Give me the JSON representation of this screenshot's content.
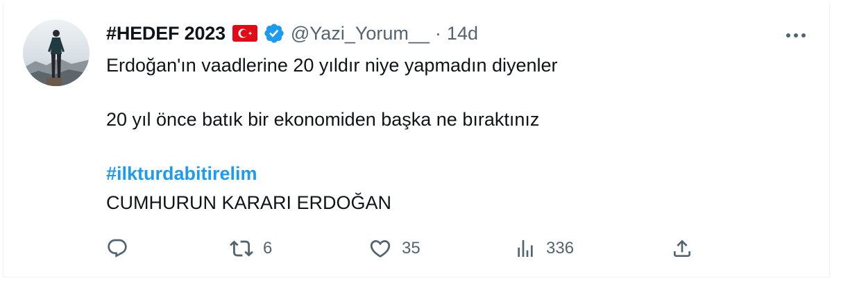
{
  "tweet": {
    "display_name": "#HEDEF 2023",
    "handle": "@Yazi_Yorum__",
    "separator": "·",
    "time": "14d",
    "lines": [
      "Erdoğan'ın vaadlerine 20 yıldır niye yapmadın diyenler",
      "20 yıl önce batık bir ekonomiden başka ne bıraktınız"
    ],
    "hashtag": "#ilkturdabitirelim",
    "closing_line": "CUMHURUN KARARI ERDOĞAN",
    "flag_icon": "turkey-flag-icon",
    "verified_icon": "verified-badge-icon"
  },
  "actions": {
    "reply": {
      "icon": "reply-icon",
      "count": ""
    },
    "retweet": {
      "icon": "retweet-icon",
      "count": "6"
    },
    "like": {
      "icon": "heart-icon",
      "count": "35"
    },
    "views": {
      "icon": "analytics-icon",
      "count": "336"
    },
    "share": {
      "icon": "share-icon",
      "count": ""
    }
  },
  "colors": {
    "text": "#0f1419",
    "secondary": "#536471",
    "accent": "#1d9bf0",
    "flag_red": "#e30a17"
  }
}
